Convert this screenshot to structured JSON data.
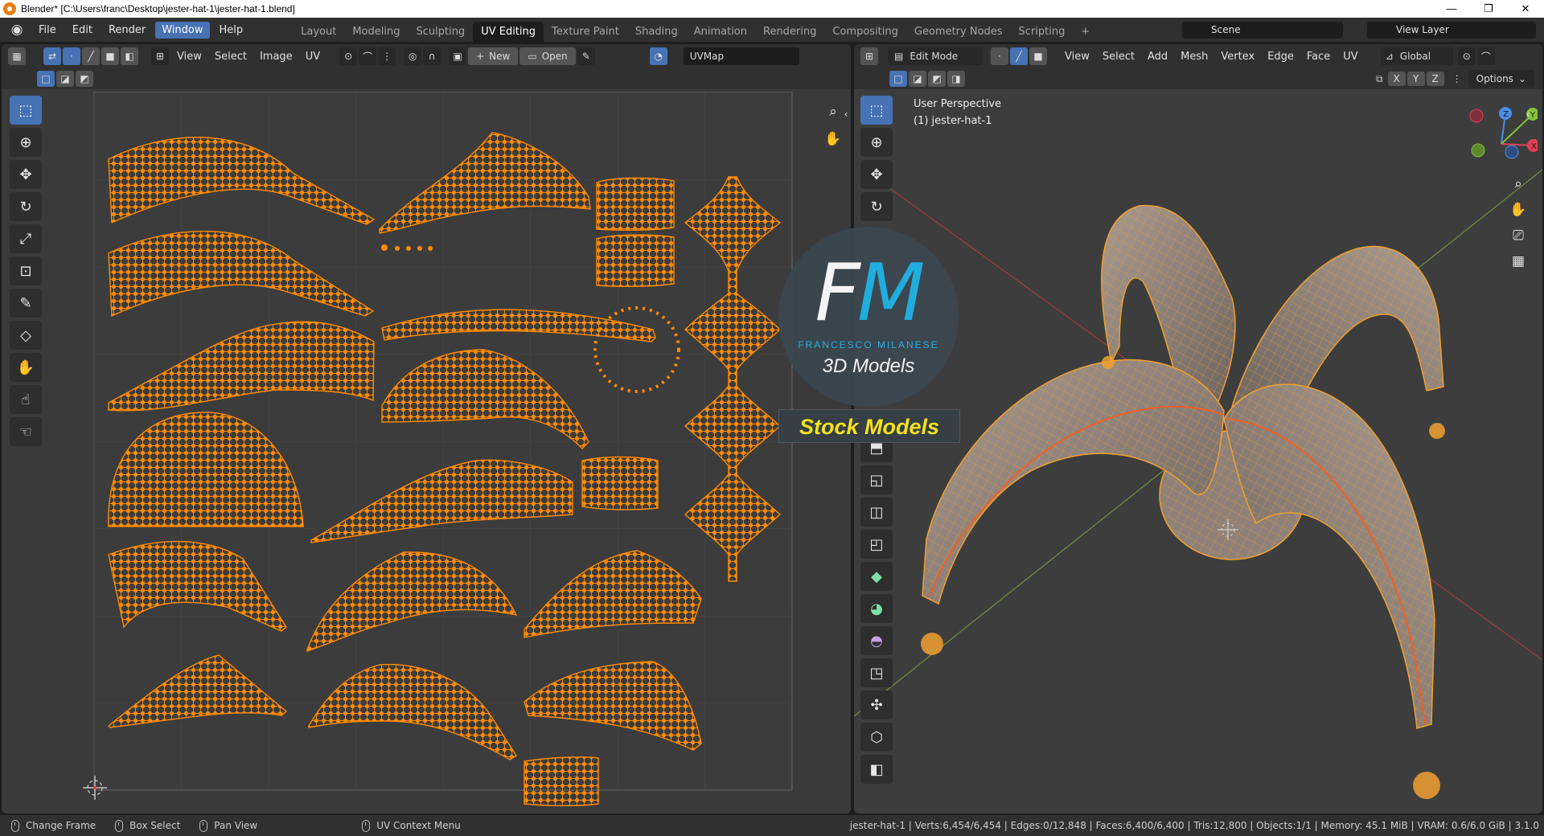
{
  "window": {
    "title": "Blender* [C:\\Users\\franc\\Desktop\\jester-hat-1\\jester-hat-1.blend]",
    "controls": [
      "—",
      "❐",
      "✕"
    ]
  },
  "topbar": {
    "menus": [
      "File",
      "Edit",
      "Render",
      "Window",
      "Help"
    ],
    "active_menu": "Window",
    "workspaces": [
      "Layout",
      "Modeling",
      "Sculpting",
      "UV Editing",
      "Texture Paint",
      "Shading",
      "Animation",
      "Rendering",
      "Compositing",
      "Geometry Nodes",
      "Scripting"
    ],
    "active_workspace": "UV Editing",
    "add_tab": "+",
    "scene": "Scene",
    "view_layer": "View Layer"
  },
  "uv_editor": {
    "menus": [
      "View",
      "Select",
      "Image",
      "UV"
    ],
    "new_label": "New",
    "open_label": "Open",
    "uvmap": "UVMap"
  },
  "viewport": {
    "mode": "Edit Mode",
    "menus": [
      "View",
      "Select",
      "Add",
      "Mesh",
      "Vertex",
      "Edge",
      "Face",
      "UV"
    ],
    "orientation": "Global",
    "axes": [
      "X",
      "Y",
      "Z"
    ],
    "options_label": "Options",
    "perspective": "User Perspective",
    "object_label": "(1) jester-hat-1",
    "gizmo": {
      "x": "X",
      "y": "Y",
      "z": "Z"
    }
  },
  "watermark": {
    "f": "F",
    "m": "M",
    "name": "FRANCESCO MILANESE",
    "sub": "3D Models",
    "stock": "Stock Models"
  },
  "statusbar": {
    "items": [
      "Change Frame",
      "Box Select",
      "Pan View",
      "UV Context Menu"
    ],
    "stats": "jester-hat-1 | Verts:6,454/6,454 | Edges:0/12,848 | Faces:6,400/6,400 | Tris:12,800 | Objects:1/1 | Memory: 45.1 MiB | VRAM: 0.6/6.0 GiB | 3.1.0"
  },
  "colors": {
    "accent": "#4772b3",
    "uv_orange": "#ff8a00",
    "mesh_orange": "#f0a030"
  }
}
